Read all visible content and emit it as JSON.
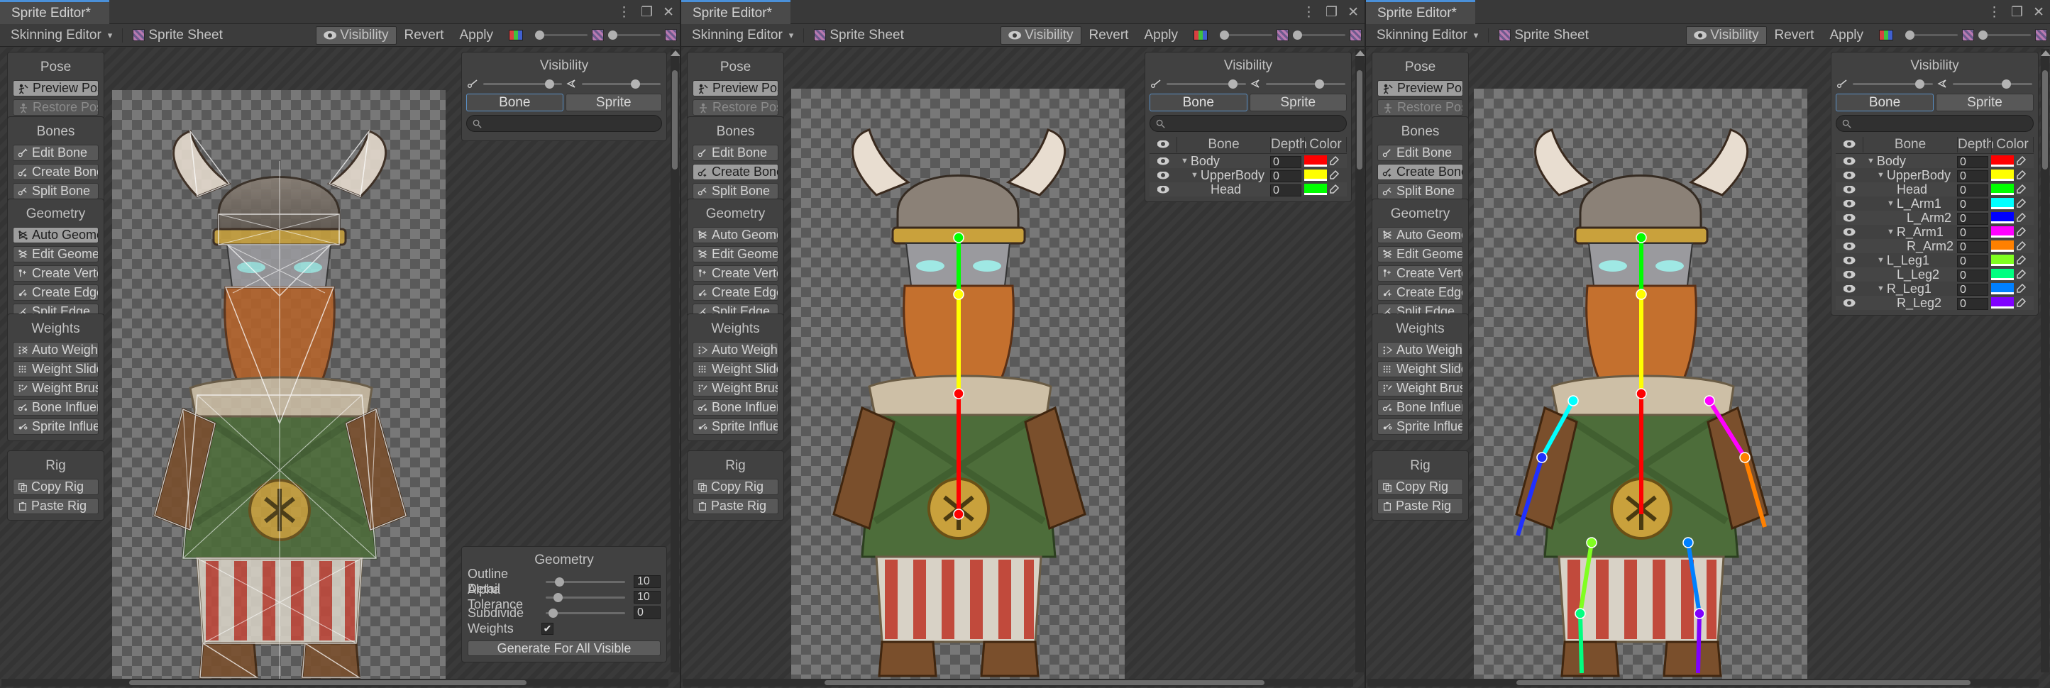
{
  "panels": [
    {
      "id": "panel-1",
      "window_tab": "Sprite Editor*",
      "toolbar": {
        "mode_dropdown": "Skinning Editor",
        "sprite_sheet": "Sprite Sheet",
        "visibility": "Visibility",
        "revert": "Revert",
        "apply": "Apply"
      },
      "show_bone_list": false,
      "show_geometry_settings": true,
      "mesh_overlay": true
    },
    {
      "id": "panel-2",
      "window_tab": "Sprite Editor*",
      "toolbar": {
        "mode_dropdown": "Skinning Editor",
        "sprite_sheet": "Sprite Sheet",
        "visibility": "Visibility",
        "revert": "Revert",
        "apply": "Apply"
      },
      "show_bone_list": true,
      "show_geometry_settings": false,
      "mesh_overlay": false
    },
    {
      "id": "panel-3",
      "window_tab": "Sprite Editor*",
      "toolbar": {
        "mode_dropdown": "Skinning Editor",
        "sprite_sheet": "Sprite Sheet",
        "visibility": "Visibility",
        "revert": "Revert",
        "apply": "Apply"
      },
      "show_bone_list": true,
      "show_geometry_settings": false,
      "mesh_overlay": false
    }
  ],
  "tools": {
    "pose": {
      "title": "Pose",
      "buttons": [
        {
          "label": "Preview Pose",
          "icon": "preview-pose-icon",
          "state": "selected"
        },
        {
          "label": "Restore Pose",
          "icon": "restore-pose-icon",
          "state": "disabled"
        }
      ]
    },
    "bones": {
      "title": "Bones",
      "buttons": [
        {
          "label": "Edit Bone",
          "icon": "edit-bone-icon",
          "state": "normal"
        },
        {
          "label": "Create Bone",
          "icon": "create-bone-icon",
          "state": "normal"
        },
        {
          "label": "Split Bone",
          "icon": "split-bone-icon",
          "state": "normal"
        }
      ]
    },
    "geometry": {
      "title": "Geometry",
      "buttons": [
        {
          "label": "Auto Geometry",
          "icon": "auto-geometry-icon",
          "state": "selected"
        },
        {
          "label": "Edit Geometry",
          "icon": "edit-geometry-icon",
          "state": "normal"
        },
        {
          "label": "Create Vertex",
          "icon": "create-vertex-icon",
          "state": "normal"
        },
        {
          "label": "Create Edge",
          "icon": "create-edge-icon",
          "state": "normal"
        },
        {
          "label": "Split Edge",
          "icon": "split-edge-icon",
          "state": "normal"
        }
      ]
    },
    "weights": {
      "title": "Weights",
      "buttons": [
        {
          "label": "Auto Weights",
          "icon": "auto-weights-icon",
          "state": "normal"
        },
        {
          "label": "Weight Slider",
          "icon": "weight-slider-icon",
          "state": "normal"
        },
        {
          "label": "Weight Brush",
          "icon": "weight-brush-icon",
          "state": "normal"
        },
        {
          "label": "Bone Influence",
          "icon": "bone-influence-icon",
          "state": "normal"
        },
        {
          "label": "Sprite Influence",
          "icon": "sprite-influence-icon",
          "state": "normal"
        }
      ]
    },
    "rig": {
      "title": "Rig",
      "buttons": [
        {
          "label": "Copy Rig",
          "icon": "copy-rig-icon",
          "state": "normal"
        },
        {
          "label": "Paste Rig",
          "icon": "paste-rig-icon",
          "state": "normal"
        }
      ]
    }
  },
  "tools_panel2": {
    "geometry_selected": "Create Bone",
    "geometry_auto_selected": false
  },
  "visibility": {
    "title": "Visibility",
    "tabs": [
      {
        "label": "Bone",
        "active": true
      },
      {
        "label": "Sprite",
        "active": false
      }
    ],
    "search_placeholder": "",
    "search_value": "",
    "columns": [
      "Bone",
      "Depth",
      "Color"
    ],
    "bone_opacity": 0.78,
    "sprite_opacity": 0.62,
    "bones_short": [
      {
        "name": "Body",
        "depth": "0",
        "color": "#ff0000",
        "indent": 0,
        "caret": true
      },
      {
        "name": "UpperBody",
        "depth": "0",
        "color": "#ffff00",
        "indent": 1,
        "caret": true
      },
      {
        "name": "Head",
        "depth": "0",
        "color": "#00ff00",
        "indent": 2,
        "caret": false
      }
    ],
    "bones_full": [
      {
        "name": "Body",
        "depth": "0",
        "color": "#ff0000",
        "indent": 0,
        "caret": true
      },
      {
        "name": "UpperBody",
        "depth": "0",
        "color": "#ffff00",
        "indent": 1,
        "caret": true
      },
      {
        "name": "Head",
        "depth": "0",
        "color": "#00ff00",
        "indent": 2,
        "caret": false
      },
      {
        "name": "L_Arm1",
        "depth": "0",
        "color": "#00ffff",
        "indent": 2,
        "caret": true
      },
      {
        "name": "L_Arm2",
        "depth": "0",
        "color": "#0000ff",
        "indent": 3,
        "caret": false
      },
      {
        "name": "R_Arm1",
        "depth": "0",
        "color": "#ff00ff",
        "indent": 2,
        "caret": true
      },
      {
        "name": "R_Arm2",
        "depth": "0",
        "color": "#ff8000",
        "indent": 3,
        "caret": false
      },
      {
        "name": "L_Leg1",
        "depth": "0",
        "color": "#80ff20",
        "indent": 1,
        "caret": true
      },
      {
        "name": "L_Leg2",
        "depth": "0",
        "color": "#00ff80",
        "indent": 2,
        "caret": false
      },
      {
        "name": "R_Leg1",
        "depth": "0",
        "color": "#0080ff",
        "indent": 1,
        "caret": true
      },
      {
        "name": "R_Leg2",
        "depth": "0",
        "color": "#8000ff",
        "indent": 2,
        "caret": false
      }
    ]
  },
  "geometry_settings": {
    "title": "Geometry",
    "rows": [
      {
        "label": "Outline Detail",
        "value": "10",
        "knob": 0.12
      },
      {
        "label": "Alpha Tolerance",
        "value": "10",
        "knob": 0.1
      },
      {
        "label": "Subdivide",
        "value": "0",
        "knob": 0.05
      }
    ],
    "weights_label": "Weights",
    "weights_checked": true,
    "generate_button": "Generate For All Visible"
  },
  "colors": {
    "accent": "#4a90d9",
    "panel_bg": "#414141",
    "window_bg": "#383838",
    "toolbar_bg": "#3c3c3c"
  }
}
